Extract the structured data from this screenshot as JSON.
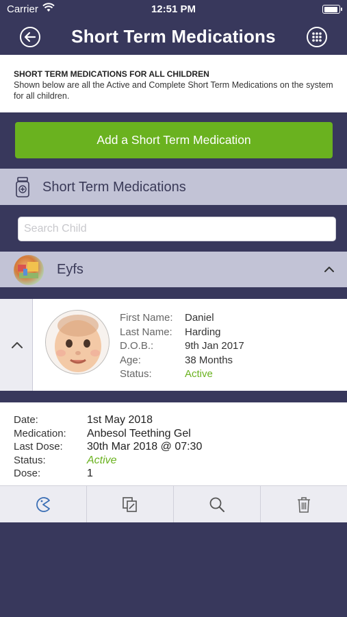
{
  "status_bar": {
    "carrier": "Carrier",
    "time": "12:51 PM",
    "battery_level": 0.95
  },
  "nav": {
    "title": "Short Term Medications",
    "back_icon": "back-arrow-icon",
    "menu_icon": "grid-menu-icon"
  },
  "info": {
    "heading": "SHORT TERM MEDICATIONS FOR ALL CHILDREN",
    "description": "Shown below are all the Active and Complete Short Term Medications on the system for all children."
  },
  "add_button_label": "Add a Short Term Medication",
  "section": {
    "label": "Short Term Medications",
    "icon": "medicine-bottle-icon"
  },
  "search": {
    "placeholder": "Search Child",
    "value": ""
  },
  "group": {
    "name": "Eyfs",
    "expanded": true
  },
  "child": {
    "first_name_label": "First Name:",
    "first_name": "Daniel",
    "last_name_label": "Last Name:",
    "last_name": "Harding",
    "dob_label": "D.O.B.:",
    "dob": "9th Jan 2017",
    "age_label": "Age:",
    "age": "38 Months",
    "status_label": "Status:",
    "status": "Active"
  },
  "medication": {
    "date_label": "Date:",
    "date": "1st May 2018",
    "medication_label": "Medication:",
    "medication": "Anbesol Teething Gel",
    "last_dose_label": "Last Dose:",
    "last_dose": "30th Mar 2018 @ 07:30",
    "status_label": "Status:",
    "status": "Active",
    "dose_label": "Dose:",
    "dose": "1"
  },
  "toolbar": [
    "pacman-icon",
    "copy-edit-icon",
    "search-icon",
    "trash-icon"
  ],
  "colors": {
    "background": "#38385c",
    "accent_green": "#6ab21f",
    "section_bg": "#c2c3d6"
  }
}
